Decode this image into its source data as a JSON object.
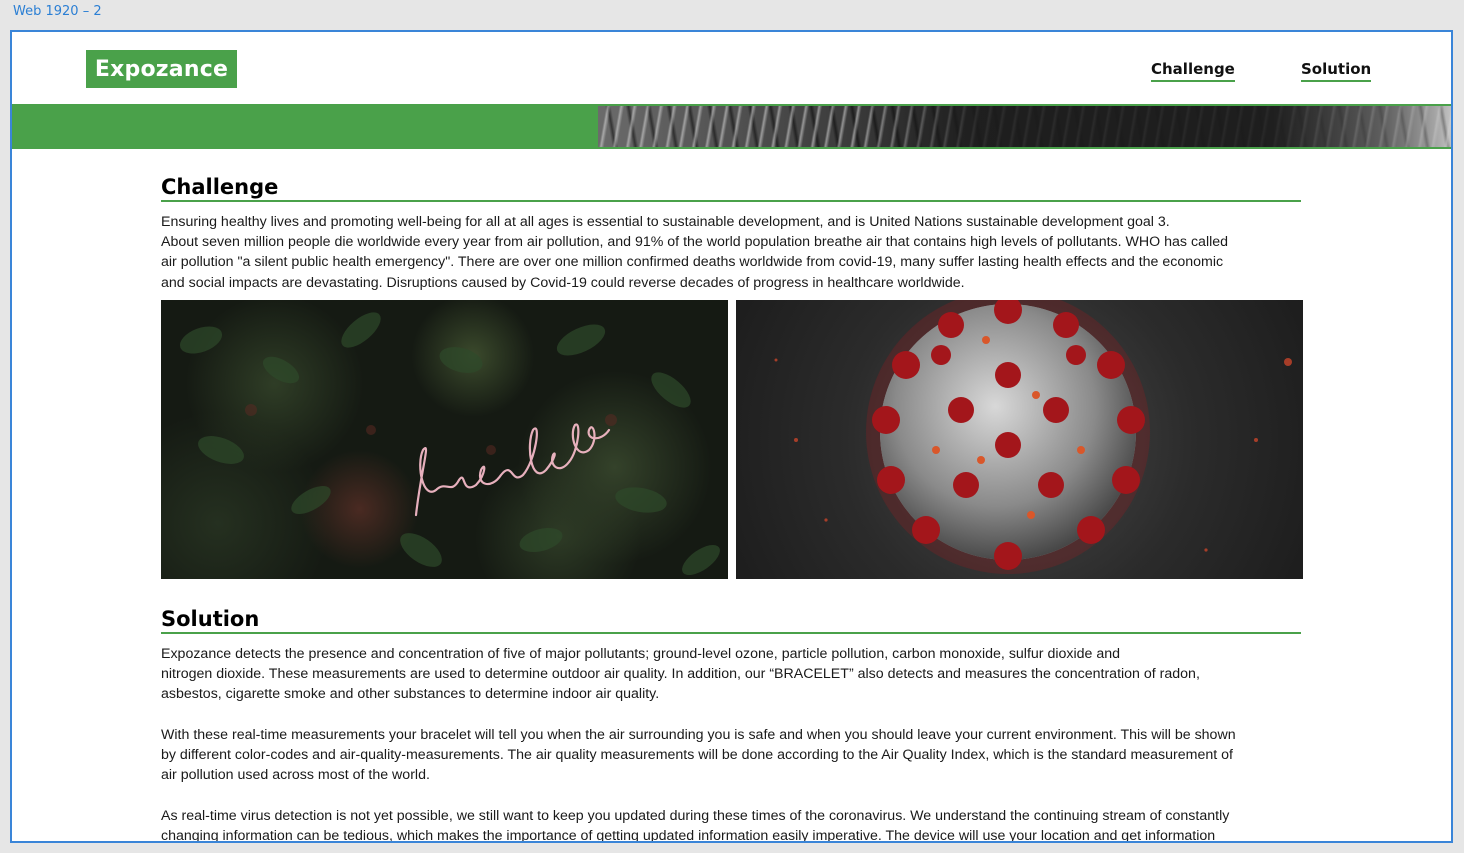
{
  "artboard": {
    "label": "Web 1920 – 2"
  },
  "header": {
    "logo": "Expozance",
    "nav": {
      "challenge": "Challenge",
      "solution": "Solution"
    }
  },
  "challenge": {
    "heading": "Challenge",
    "lines": [
      "Ensuring healthy lives and promoting well-being for all at all ages is essential to sustainable development, and is United Nations sustainable development goal 3.",
      "About seven million people die worldwide every year from air pollution, and 91% of the world population breathe air that contains high levels of pollutants. WHO has called",
      "air pollution \"a silent public health emergency\". There are over one million confirmed deaths worldwide from covid-19, many suffer lasting health effects and the economic",
      "and social impacts are devastating. Disruptions caused by Covid-19 could reverse decades of progress in healthcare worldwide."
    ],
    "images": {
      "left_neon_text": "breathe"
    }
  },
  "solution": {
    "heading": "Solution",
    "lines": [
      "Expozance detects the presence and concentration of five of major pollutants; ground-level ozone, particle pollution, carbon monoxide, sulfur dioxide and",
      "nitrogen dioxide. These measurements are used to determine outdoor air quality. In addition, our “BRACELET” also detects and measures the concentration of radon,",
      "asbestos, cigarette smoke and other substances to determine indoor air quality.",
      "With these real-time measurements your bracelet will tell you when the air surrounding you is safe and when you should leave your current environment. This will be shown",
      "by different color-codes and air-quality-measurements. The air quality measurements will be done according to the Air Quality Index, which is the standard measurement of",
      "air pollution used across most of the world.",
      "As real-time virus detection is not yet possible, we still want to keep you updated during these times of the coronavirus. We understand the continuing stream of constantly",
      "changing information can be tedious, which makes the importance of getting updated information easily imperative. The device will use your location and get information"
    ]
  },
  "colors": {
    "brand_green": "#4aa14a",
    "artboard_border": "#3a85d8",
    "virus_red": "#a3161b"
  }
}
